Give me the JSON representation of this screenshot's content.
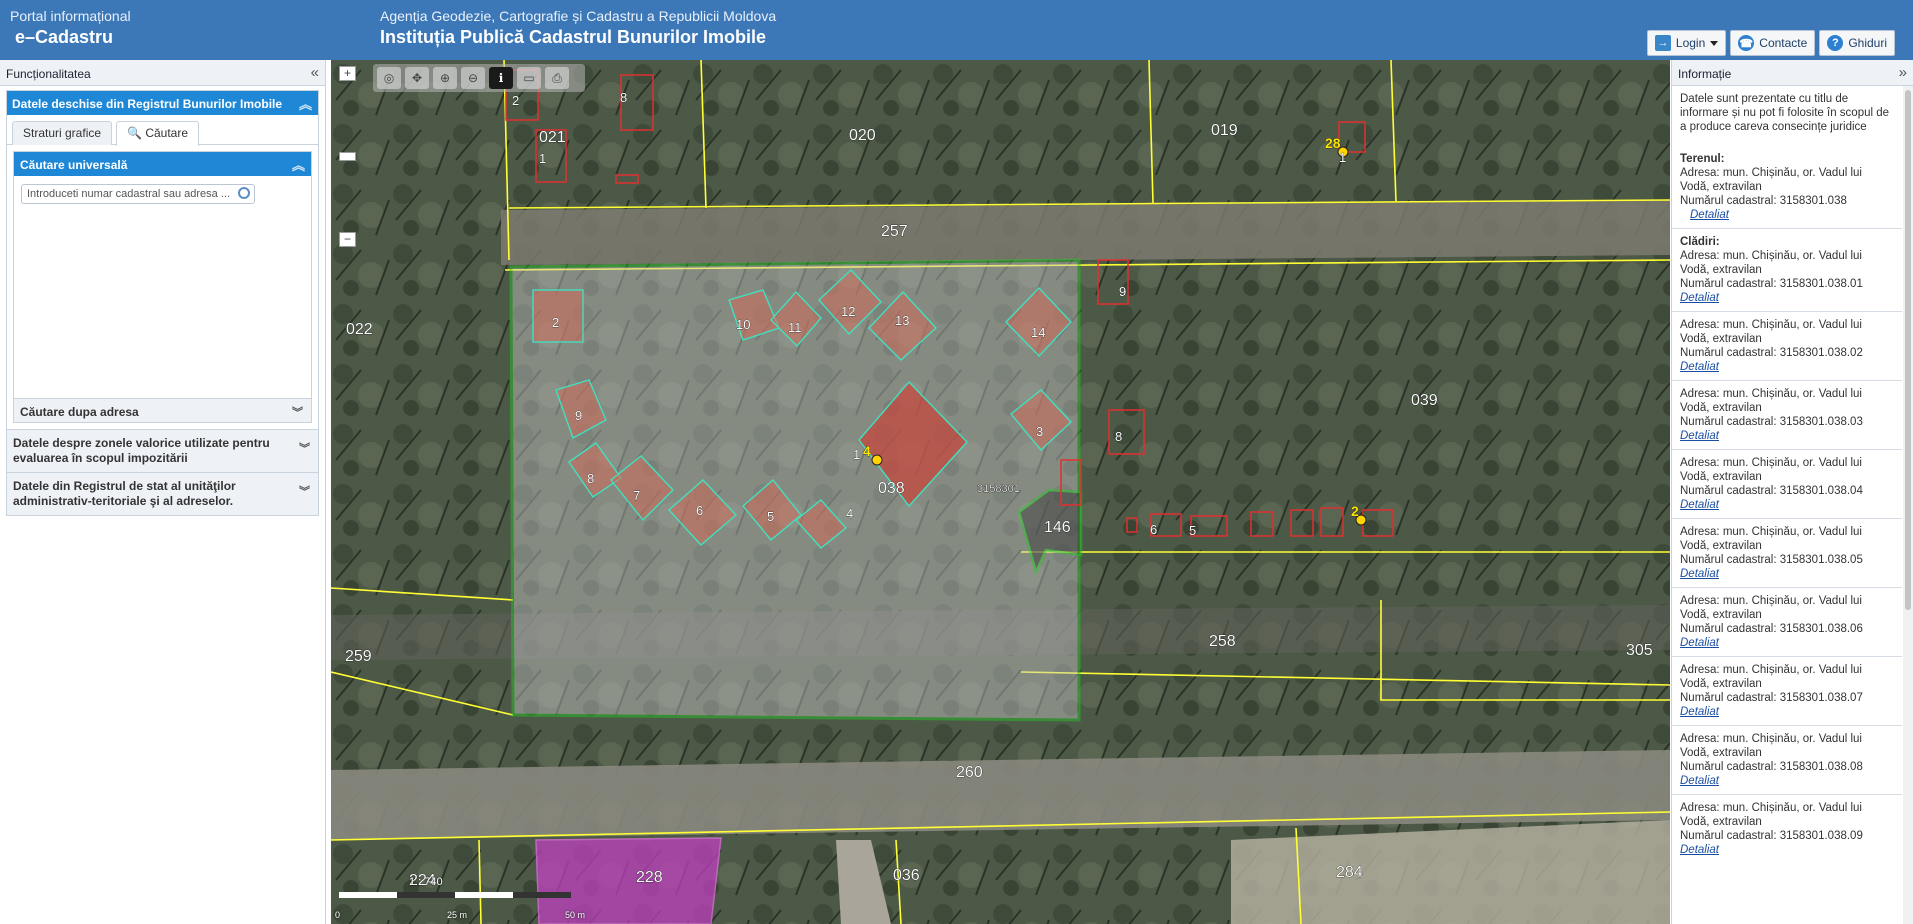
{
  "header": {
    "portal": "Portal informațional",
    "app": "e–Cadastru",
    "agency": "Agenția Geodezie, Cartografie și Cadastru a Republicii Moldova",
    "institution": "Instituția Publică Cadastrul Bunurilor Imobile",
    "buttons": {
      "login": "Login",
      "contacts": "Contacte",
      "guides": "Ghiduri"
    }
  },
  "left_panel": {
    "title": "Funcționalitatea",
    "open_registry": "Datele deschise din Registrul Bunurilor Imobile",
    "tabs": [
      "Straturi grafice",
      "Căutare"
    ],
    "universal_search": "Căutare universală",
    "search_placeholder": "Introduceti numar cadastral sau adresa ...",
    "search_by_address": "Căutare dupa adresa",
    "valuation_zones": "Datele despre zonele valorice utilizate pentru evaluarea în scopul impozitării",
    "state_registry": "Datele din Registrul de stat al unităţilor administrativ-teritoriale şi al adreselor."
  },
  "map": {
    "zoom_in": "+",
    "zoom_out": "−",
    "scale_ratio": "1 : 740",
    "scale_ticks": [
      "0",
      "25 m",
      "50 m"
    ],
    "labels": {
      "block_021": "021",
      "block_020": "020",
      "block_019": "019",
      "block_022": "022",
      "block_257": "257",
      "block_039": "039",
      "block_038": "038",
      "block_146": "146",
      "block_258": "258",
      "block_259": "259",
      "block_260": "260",
      "block_305": "305",
      "block_224": "224",
      "block_228": "228",
      "block_036": "036",
      "block_284": "284",
      "cad_3158301": "3158301"
    },
    "buildings_038": [
      "1",
      "2",
      "3",
      "4",
      "5",
      "6",
      "7",
      "8",
      "9",
      "10",
      "11",
      "12",
      "13",
      "14"
    ],
    "address_points": [
      "4",
      "28",
      "2"
    ],
    "other_building_nums": [
      "2",
      "1",
      "8",
      "1",
      "9",
      "8",
      "6",
      "5"
    ]
  },
  "right_panel": {
    "title": "Informație",
    "disclaimer": "Datele sunt prezentate cu titlu de informare și nu pot fi folosite în scopul de a produce careva consecințe juridice",
    "land": {
      "title": "Terenul:",
      "address": "Adresa: mun. Chișinău, or. Vadul lui Vodă, extravilan",
      "cadastral": "Numărul cadastral: 3158301.038",
      "link": "Detaliat"
    },
    "buildings_title": "Clădiri:",
    "buildings": [
      {
        "address": "Adresa: mun. Chișinău, or. Vadul lui Vodă, extravilan",
        "cadastral": "Numărul cadastral: 3158301.038.01",
        "link": "Detaliat"
      },
      {
        "address": "Adresa: mun. Chișinău, or. Vadul lui Vodă, extravilan",
        "cadastral": "Numărul cadastral: 3158301.038.02",
        "link": "Detaliat"
      },
      {
        "address": "Adresa: mun. Chișinău, or. Vadul lui Vodă, extravilan",
        "cadastral": "Numărul cadastral: 3158301.038.03",
        "link": "Detaliat"
      },
      {
        "address": "Adresa: mun. Chișinău, or. Vadul lui Vodă, extravilan",
        "cadastral": "Numărul cadastral: 3158301.038.04",
        "link": "Detaliat"
      },
      {
        "address": "Adresa: mun. Chișinău, or. Vadul lui Vodă, extravilan",
        "cadastral": "Numărul cadastral: 3158301.038.05",
        "link": "Detaliat"
      },
      {
        "address": "Adresa: mun. Chișinău, or. Vadul lui Vodă, extravilan",
        "cadastral": "Numărul cadastral: 3158301.038.06",
        "link": "Detaliat"
      },
      {
        "address": "Adresa: mun. Chișinău, or. Vadul lui Vodă, extravilan",
        "cadastral": "Numărul cadastral: 3158301.038.07",
        "link": "Detaliat"
      },
      {
        "address": "Adresa: mun. Chișinău, or. Vadul lui Vodă, extravilan",
        "cadastral": "Numărul cadastral: 3158301.038.08",
        "link": "Detaliat"
      },
      {
        "address": "Adresa: mun. Chișinău, or. Vadul lui Vodă, extravilan",
        "cadastral": "Numărul cadastral: 3158301.038.09",
        "link": "Detaliat"
      }
    ]
  },
  "colors": {
    "header_bg": "#3c78b8",
    "accordion_bg": "#1f88d6",
    "parcel_boundary": "#ffff33",
    "selected_parcel": "#22cc22",
    "building_outline": "#e03030",
    "selected_building": "#40e0c0",
    "highlight_parcel": "#c040c0"
  }
}
